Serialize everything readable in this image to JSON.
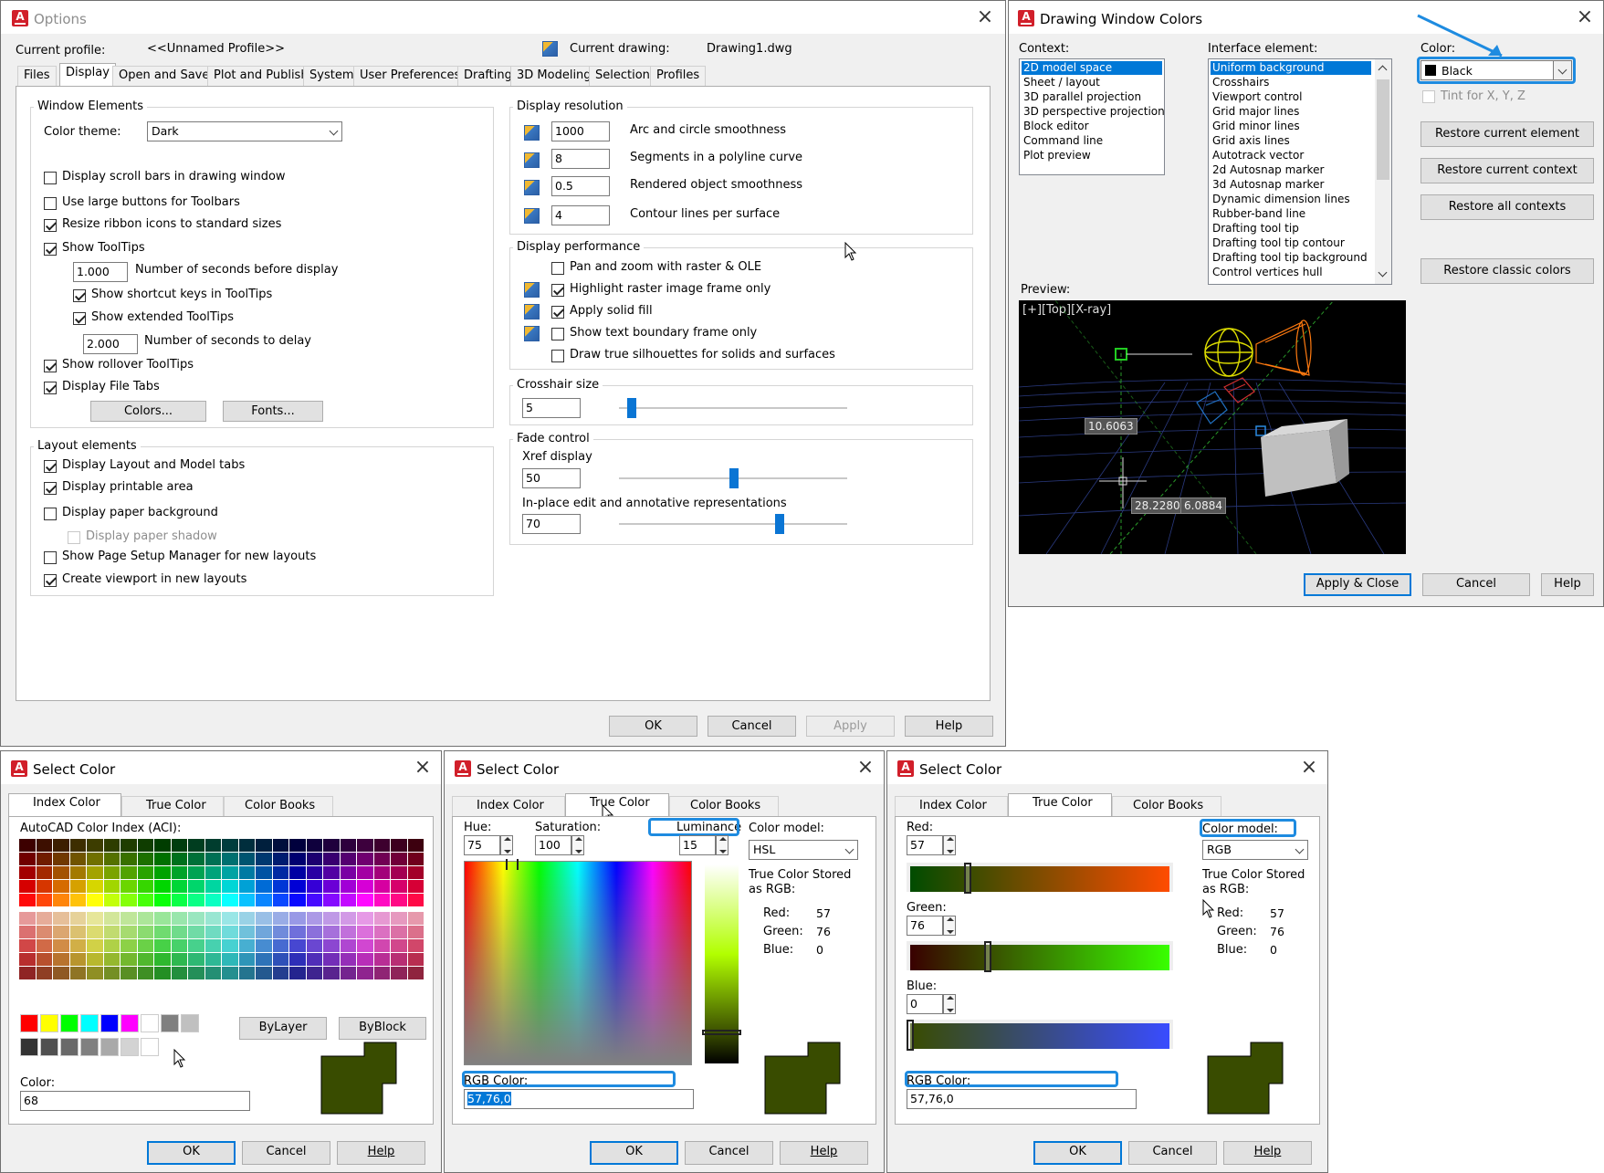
{
  "options": {
    "title": "Options",
    "current_profile_label": "Current profile:",
    "current_profile": "<<Unnamed Profile>>",
    "current_drawing_label": "Current drawing:",
    "current_drawing": "Drawing1.dwg",
    "tabs": [
      "Files",
      "Display",
      "Open and Save",
      "Plot and Publish",
      "System",
      "User Preferences",
      "Drafting",
      "3D Modeling",
      "Selection",
      "Profiles"
    ],
    "window_elements": {
      "title": "Window Elements",
      "color_theme_label": "Color theme:",
      "color_theme": "Dark",
      "checkboxes": [
        "Display scroll bars in drawing window",
        "Use large buttons for Toolbars",
        "Resize ribbon icons to standard sizes",
        "Show ToolTips",
        "Show shortcut keys in ToolTips",
        "Show extended ToolTips",
        "Show rollover ToolTips",
        "Display File Tabs"
      ],
      "tooltip_delay": "1.000",
      "tooltip_delay_label": "Number of seconds before display",
      "ext_delay": "2.000",
      "ext_delay_label": "Number of seconds to delay",
      "colors_btn": "Colors...",
      "fonts_btn": "Fonts..."
    },
    "layout_elements": {
      "title": "Layout elements",
      "checkboxes": [
        "Display Layout and Model tabs",
        "Display printable area",
        "Display paper background",
        "Display paper shadow",
        "Show Page Setup Manager for new layouts",
        "Create viewport in new layouts"
      ]
    },
    "display_resolution": {
      "title": "Display resolution",
      "rows": [
        {
          "value": "1000",
          "label": "Arc and circle smoothness"
        },
        {
          "value": "8",
          "label": "Segments in a polyline curve"
        },
        {
          "value": "0.5",
          "label": "Rendered object smoothness"
        },
        {
          "value": "4",
          "label": "Contour lines per surface"
        }
      ]
    },
    "display_performance": {
      "title": "Display performance",
      "checkboxes": [
        "Pan and zoom with raster & OLE",
        "Highlight raster image frame only",
        "Apply solid fill",
        "Show text boundary frame only",
        "Draw true silhouettes for solids and surfaces"
      ]
    },
    "crosshair": {
      "title": "Crosshair size",
      "value": "5",
      "level": 5
    },
    "fade": {
      "title": "Fade control",
      "xref_label": "Xref display",
      "xref_value": "50",
      "xref_level": 50,
      "inplace_label": "In-place edit and annotative representations",
      "inplace_value": "70",
      "inplace_level": 70
    },
    "buttons": {
      "ok": "OK",
      "cancel": "Cancel",
      "apply": "Apply",
      "help": "Help"
    }
  },
  "dwc": {
    "title": "Drawing Window Colors",
    "context_label": "Context:",
    "contexts": [
      "2D model space",
      "Sheet / layout",
      "3D parallel projection",
      "3D perspective projection",
      "Block editor",
      "Command line",
      "Plot preview"
    ],
    "interface_label": "Interface element:",
    "elements": [
      "Uniform background",
      "Crosshairs",
      "Viewport control",
      "Grid major lines",
      "Grid minor lines",
      "Grid axis lines",
      "Autotrack vector",
      "2d Autosnap marker",
      "3d Autosnap marker",
      "Dynamic dimension lines",
      "Rubber-band line",
      "Drafting tool tip",
      "Drafting tool tip contour",
      "Drafting tool tip background",
      "Control vertices hull"
    ],
    "color_label": "Color:",
    "color_value": "Black",
    "tint_label": "Tint for X, Y, Z",
    "restore_element": "Restore current element",
    "restore_context": "Restore current context",
    "restore_all": "Restore all contexts",
    "restore_classic": "Restore classic colors",
    "preview_label": "Preview:",
    "viewport_label": "[+][Top][X-ray]",
    "dim1": "10.6063",
    "dim2": "28.2280",
    "dim3": "6.0884",
    "apply_close": "Apply & Close",
    "cancel": "Cancel",
    "help": "Help"
  },
  "sc": {
    "title": "Select Color",
    "tabs": [
      "Index Color",
      "True Color",
      "Color Books"
    ],
    "aci_label": "AutoCAD Color Index (ACI):",
    "bylayer": "ByLayer",
    "byblock": "ByBlock",
    "color_label": "Color:",
    "color_value": "68",
    "ok": "OK",
    "cancel": "Cancel",
    "help": "Help",
    "hue_label": "Hue:",
    "hue": "75",
    "sat_label": "Saturation:",
    "sat": "100",
    "lum_label": "Luminance",
    "lum": "15",
    "model_label": "Color model:",
    "model_hsl": "HSL",
    "model_rgb": "RGB",
    "stored_label": "True Color Stored as RGB:",
    "red_label": "Red:",
    "green_label": "Green:",
    "blue_label": "Blue:",
    "red": "57",
    "green": "76",
    "blue": "0",
    "rgb_label": "RGB Color:",
    "rgb_value": "57,76,0",
    "swatch_color": "#394c00"
  }
}
